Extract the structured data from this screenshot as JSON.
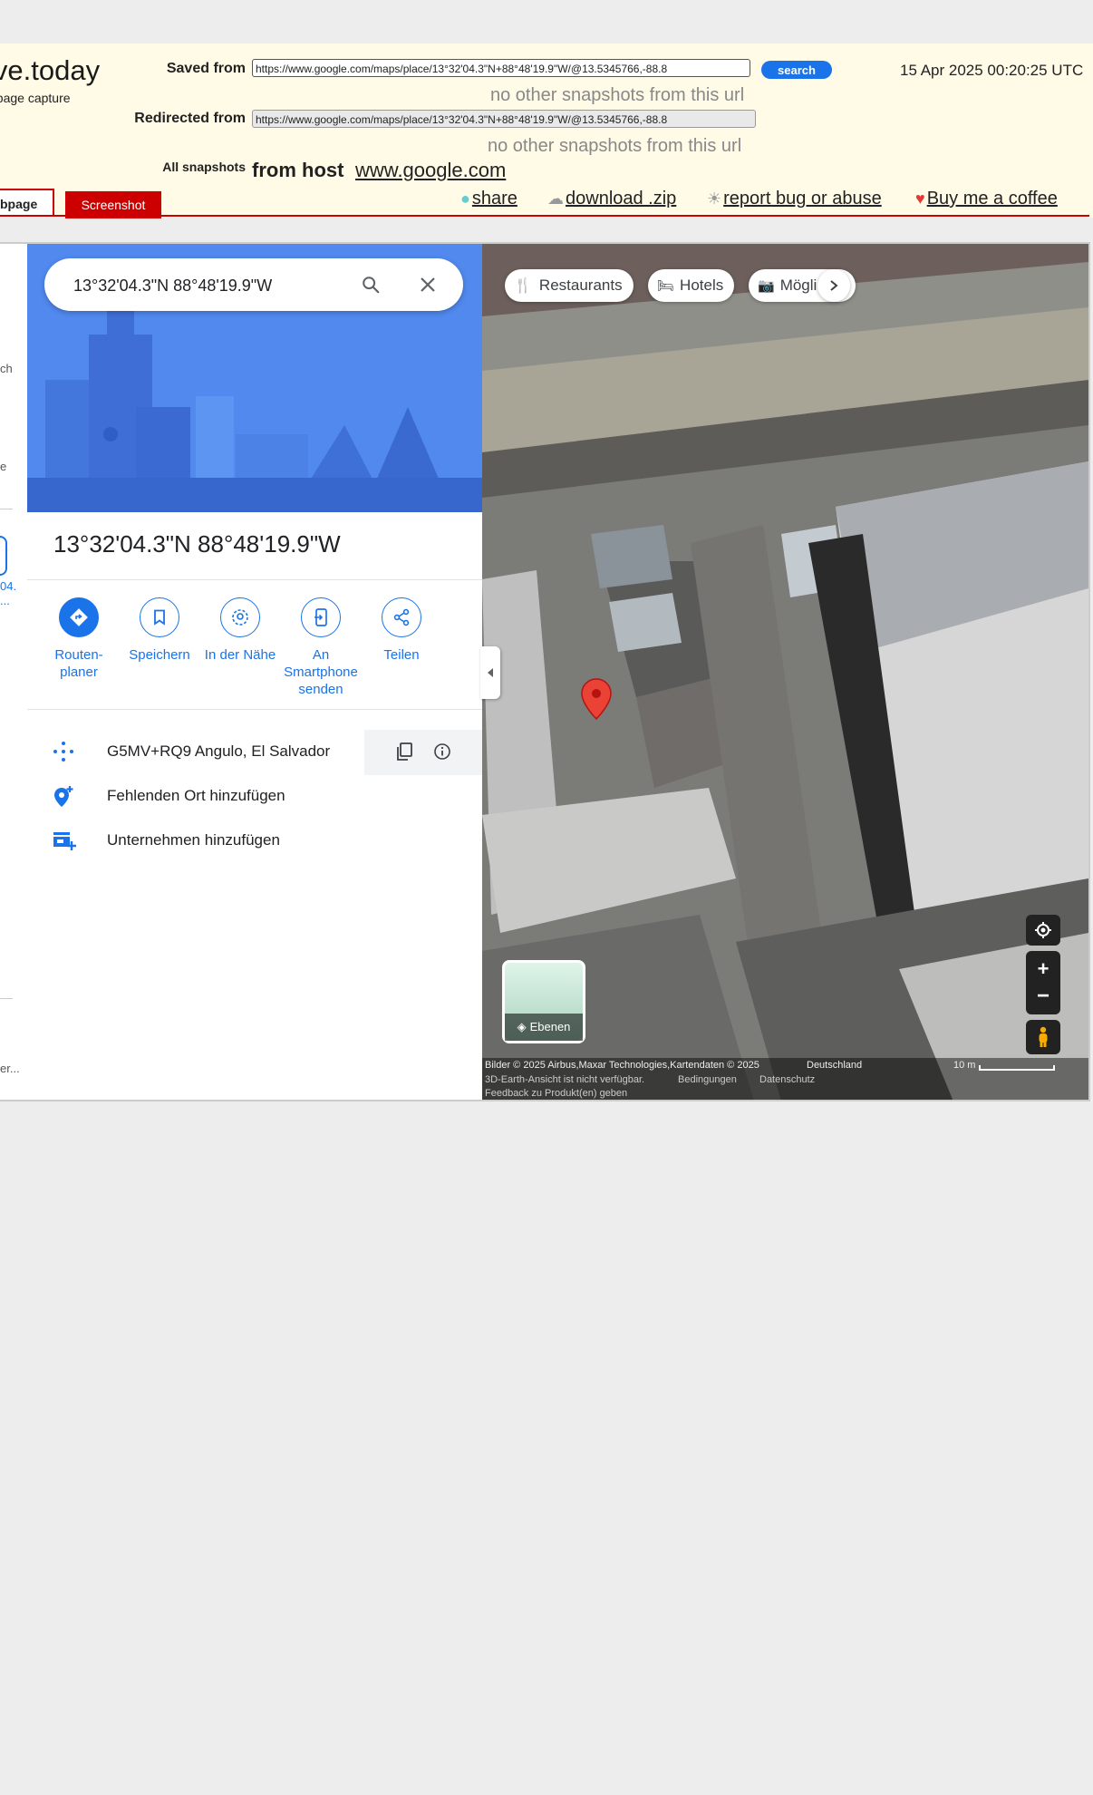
{
  "archive": {
    "logo": "ive.today",
    "logo_sub": "bpage capture",
    "saved_from_label": "Saved from",
    "saved_from_url": "https://www.google.com/maps/place/13°32'04.3\"N+88°48'19.9\"W/@13.5345766,-88.8",
    "search_label": "search",
    "timestamp": "15 Apr 2025 00:20:25 UTC",
    "no_other_1": "no other snapshots from this url",
    "redirected_from_label": "Redirected from",
    "redirected_from_url": "https://www.google.com/maps/place/13°32'04.3\"N+88°48'19.9\"W/@13.5345766,-88.8",
    "no_other_2": "no other snapshots from this url",
    "all_snapshots_label": "All snapshots",
    "from_host_label": "from host",
    "host": "www.google.com",
    "tab_webpage": "bpage",
    "tab_screenshot": "Screenshot",
    "actions": {
      "share": "share",
      "download": "download .zip",
      "report": "report bug or abuse",
      "coffee": "Buy me a coffee"
    }
  },
  "left_strip": {
    "text1": "ch",
    "text2": "e",
    "text3": "04.",
    "text4": "...",
    "text5": "er..."
  },
  "maps": {
    "search_value": "13°32'04.3\"N 88°48'19.9\"W",
    "place_title": "13°32'04.3\"N 88°48'19.9\"W",
    "actions": [
      {
        "label1": "Routen-",
        "label2": "planer"
      },
      {
        "label1": "Speichern",
        "label2": ""
      },
      {
        "label1": "In der Nähe",
        "label2": ""
      },
      {
        "label1": "An",
        "label2": "Smartphone",
        "label3": "senden"
      },
      {
        "label1": "Teilen",
        "label2": ""
      }
    ],
    "plus_code": "G5MV+RQ9 Angulo, El Salvador",
    "add_missing": "Fehlenden Ort hinzufügen",
    "add_business": "Unternehmen hinzufügen",
    "chips": {
      "restaurants": "Restaurants",
      "hotels": "Hotels",
      "more": "Mögli"
    },
    "layers_label": "Ebenen",
    "attribution": {
      "line1": "Bilder © 2025 Airbus,Maxar Technologies,Kartendaten © 2025",
      "country": "Deutschland",
      "scale": "10 m",
      "line2a": "3D-Earth-Ansicht ist nicht verfügbar.",
      "line2b": "Bedingungen",
      "line2c": "Datenschutz",
      "line3": "Feedback zu Produkt(en) geben"
    },
    "colors": {
      "accent": "#1a73e8",
      "marker": "#ea4335",
      "archive_red": "#cc0000",
      "archive_bg": "#fffbe6"
    }
  }
}
